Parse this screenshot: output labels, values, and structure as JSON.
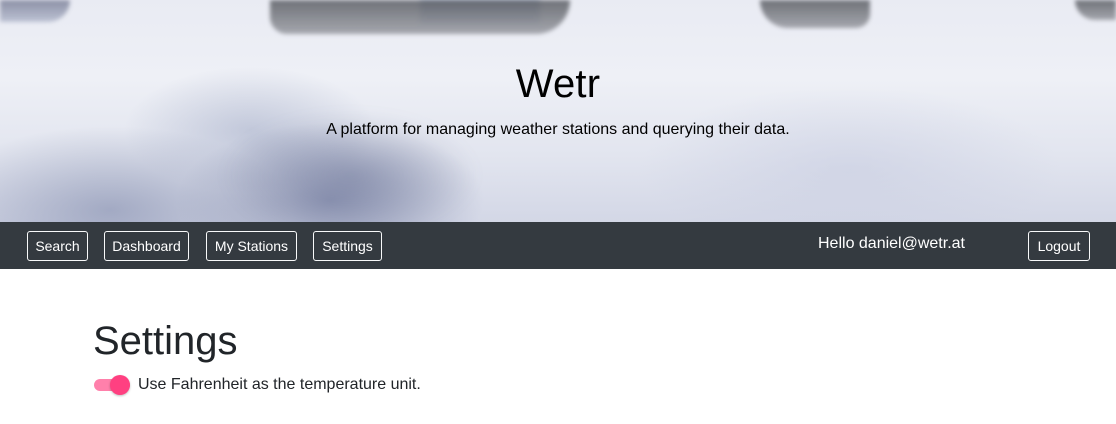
{
  "hero": {
    "title": "Wetr",
    "subtitle": "A platform for managing weather stations and querying their data."
  },
  "nav": {
    "items": [
      {
        "label": "Search"
      },
      {
        "label": "Dashboard"
      },
      {
        "label": "My Stations"
      },
      {
        "label": "Settings"
      }
    ],
    "greeting": "Hello daniel@wetr.at",
    "logout_label": "Logout"
  },
  "main": {
    "title": "Settings",
    "settings": [
      {
        "label": "Use Fahrenheit as the temperature unit.",
        "enabled": true
      }
    ]
  },
  "colors": {
    "navbar": "#343a40",
    "toggle_accent": "#ff4081",
    "toggle_track": "#ff80ab"
  }
}
